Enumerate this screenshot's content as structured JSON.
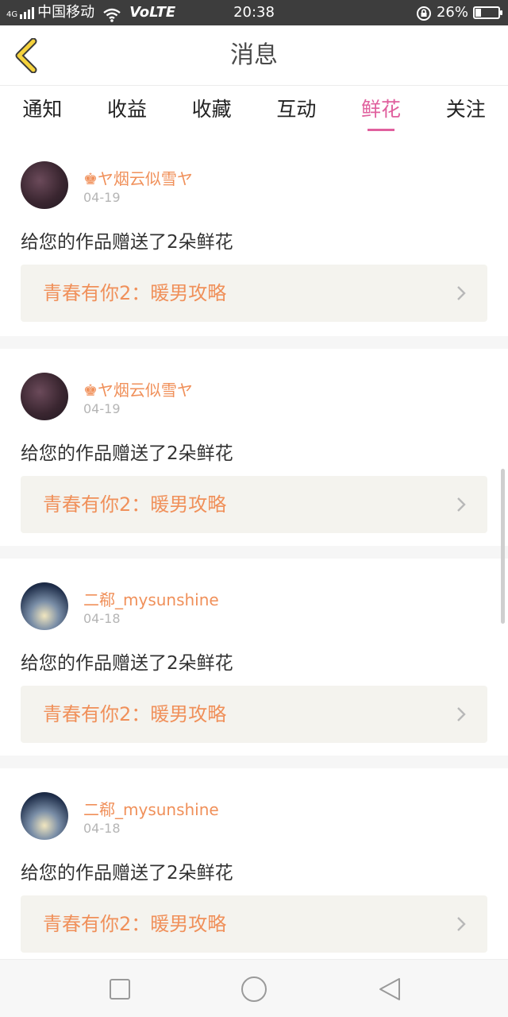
{
  "status_bar": {
    "signal_label": "4G",
    "carrier": "中国移动",
    "volte": "VoLTE",
    "time": "20:38",
    "battery_percent": "26%",
    "battery_level": 0.26
  },
  "header": {
    "title": "消息"
  },
  "tabs": [
    {
      "label": "通知",
      "active": false
    },
    {
      "label": "收益",
      "active": false
    },
    {
      "label": "收藏",
      "active": false
    },
    {
      "label": "互动",
      "active": false
    },
    {
      "label": "鲜花",
      "active": true
    },
    {
      "label": "关注",
      "active": false
    }
  ],
  "messages": [
    {
      "username": "♚ヤ烟云似雪ヤ",
      "date": "04-19",
      "text": "给您的作品赠送了2朵鲜花",
      "work_title": "青春有你2：暖男攻略"
    },
    {
      "username": "♚ヤ烟云似雪ヤ",
      "date": "04-19",
      "text": "给您的作品赠送了2朵鲜花",
      "work_title": "青春有你2：暖男攻略"
    },
    {
      "username": "二郗_mysunshine",
      "date": "04-18",
      "text": "给您的作品赠送了2朵鲜花",
      "work_title": "青春有你2：暖男攻略"
    },
    {
      "username": "二郗_mysunshine",
      "date": "04-18",
      "text": "给您的作品赠送了2朵鲜花",
      "work_title": "青春有你2：暖男攻略"
    }
  ],
  "colors": {
    "accent_pink": "#e0609e",
    "accent_orange": "#f0905a",
    "back_icon": "#f5d23c"
  },
  "icons": {
    "back": "chevron-left-icon",
    "item_arrow": "chevron-right-icon",
    "nav_recent": "square-icon",
    "nav_home": "circle-icon",
    "nav_back": "triangle-back-icon"
  }
}
